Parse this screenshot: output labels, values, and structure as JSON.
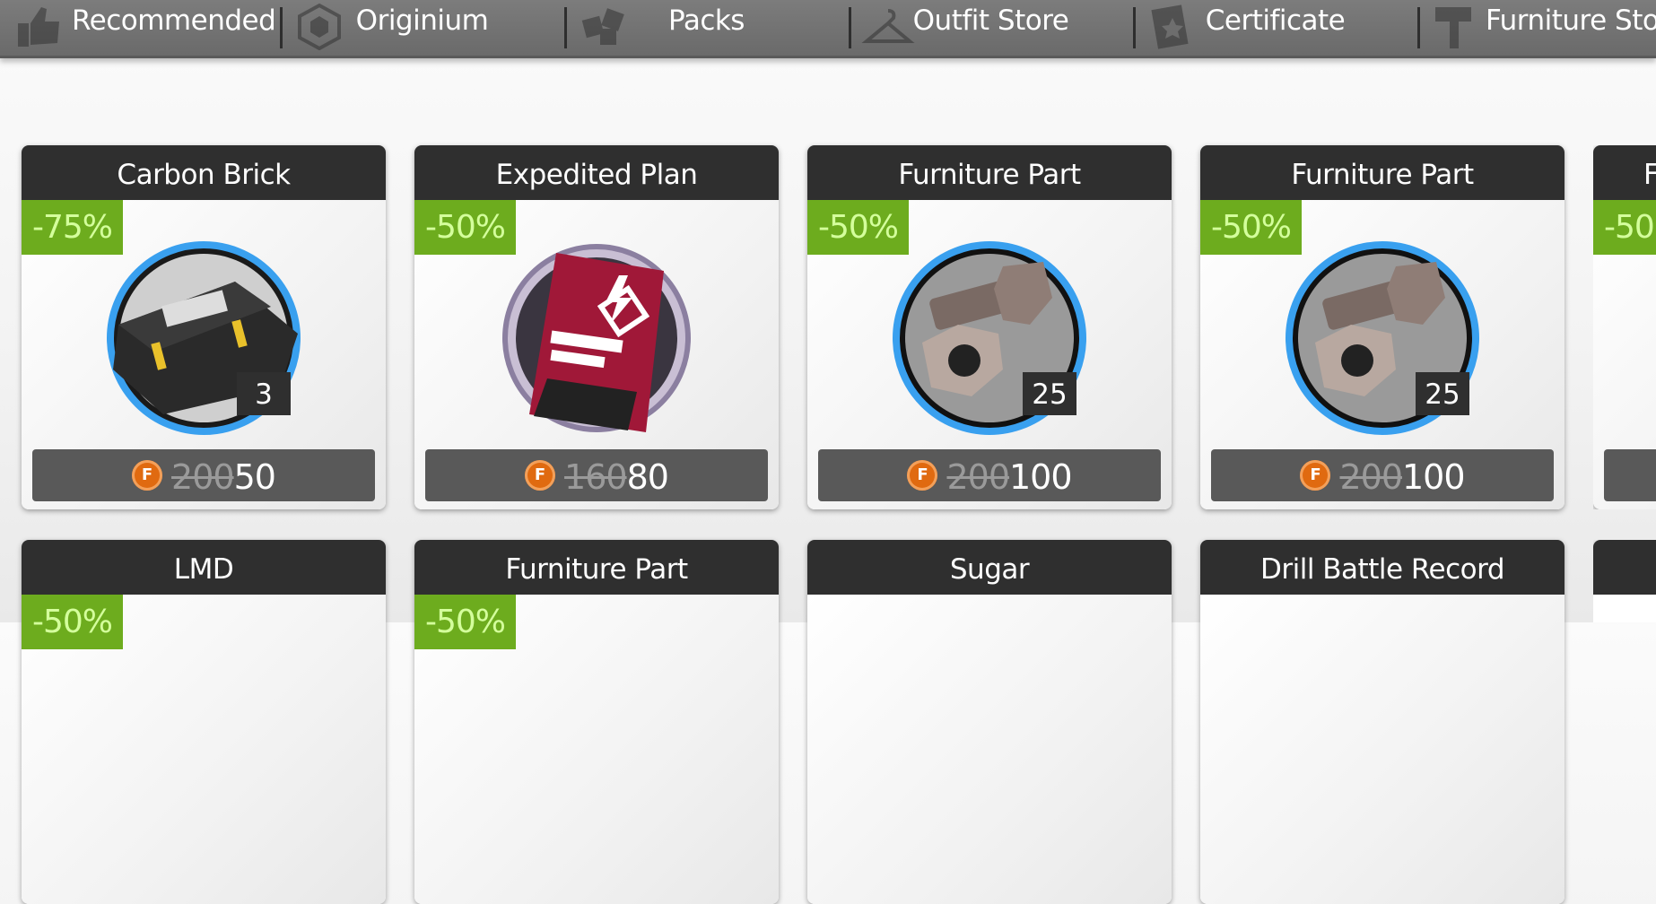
{
  "nav": {
    "tabs": [
      {
        "label": "Recommended",
        "icon": "thumbs-up-icon"
      },
      {
        "label": "Originium",
        "icon": "originium-icon"
      },
      {
        "label": "Packs",
        "icon": "packs-icon"
      },
      {
        "label": "Outfit Store",
        "icon": "hanger-icon"
      },
      {
        "label": "Certificate",
        "icon": "certificate-icon"
      },
      {
        "label": "Furniture Stor",
        "icon": "hammer-icon"
      }
    ]
  },
  "items": [
    {
      "name": "Carbon Brick",
      "discount": "-75%",
      "quantity": "3",
      "old_price": "200",
      "new_price": "50",
      "icon": "carbon-brick-icon"
    },
    {
      "name": "Expedited Plan",
      "discount": "-50%",
      "quantity": "",
      "old_price": "160",
      "new_price": "80",
      "icon": "expedited-plan-icon"
    },
    {
      "name": "Furniture Part",
      "discount": "-50%",
      "quantity": "25",
      "old_price": "200",
      "new_price": "100",
      "icon": "furniture-part-icon"
    },
    {
      "name": "Furniture Part",
      "discount": "-50%",
      "quantity": "25",
      "old_price": "200",
      "new_price": "100",
      "icon": "furniture-part-icon"
    },
    {
      "name": "F",
      "discount": "-50",
      "quantity": "",
      "old_price": "",
      "new_price": "",
      "icon": "furniture-part-icon"
    }
  ],
  "items_row2": [
    {
      "name": "LMD",
      "discount": "-50%"
    },
    {
      "name": "Furniture Part",
      "discount": "-50%"
    },
    {
      "name": "Sugar",
      "discount": ""
    },
    {
      "name": "Drill Battle Record",
      "discount": ""
    }
  ],
  "colors": {
    "discount_badge": "#6dac1e",
    "discount_text": "#d4ff9c",
    "header": "#2f2f2f",
    "price_bar": "#595959",
    "coin": "#e06a10",
    "ring": "#39a0ef"
  }
}
